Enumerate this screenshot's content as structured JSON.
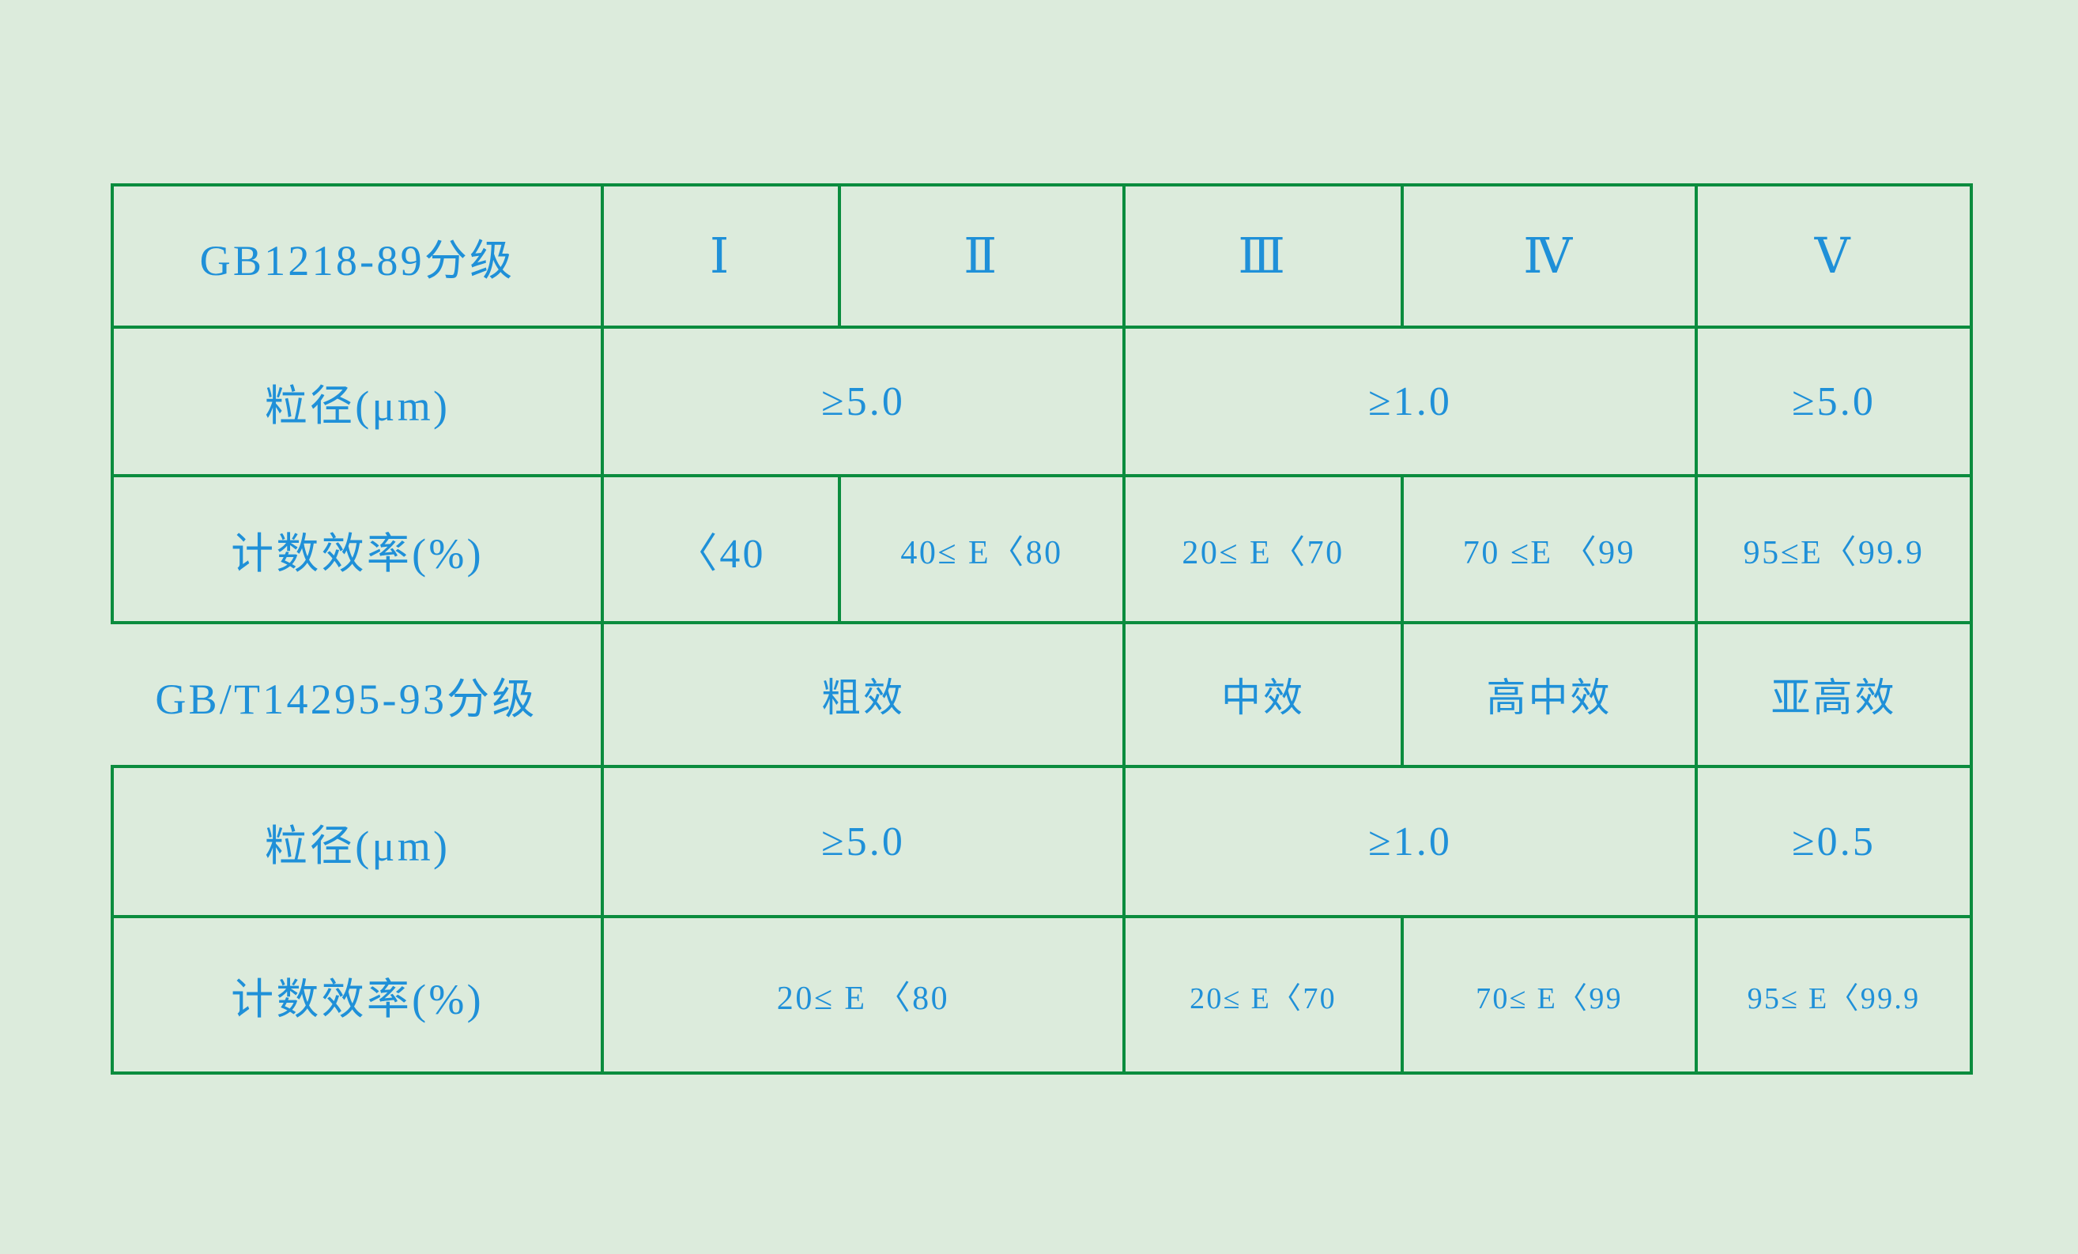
{
  "page": {
    "background_color": "#dcebdc",
    "border_color": "#0b8c3e",
    "text_color": "#1f90d8"
  },
  "table": {
    "row_labels": {
      "gb1218_grade": "GB1218-89分级",
      "particle_size_1": "粒径(μm)",
      "count_efficiency_1": "计数效率(%)",
      "gbt14295_grade": "GB/T14295-93分级",
      "particle_size_2": "粒径(μm)",
      "count_efficiency_2": "计数效率(%)"
    },
    "grade_columns": {
      "c1": "Ⅰ",
      "c2": "Ⅱ",
      "c3": "Ⅲ",
      "c4": "Ⅳ",
      "c5": "Ⅴ"
    },
    "row_particle_size_1": {
      "span_c1_c2": "≥5.0",
      "span_c3_c4": "≥1.0",
      "c5": "≥5.0"
    },
    "row_count_efficiency_1": {
      "c1": "〈40",
      "c2": "40≤ E〈80",
      "c3": "20≤ E〈70",
      "c4": "70 ≤E 〈99",
      "c5": "95≤E〈99.9"
    },
    "row_gbt14295_grade": {
      "span_c1_c2": "粗效",
      "c3": "中效",
      "c4": "高中效",
      "c5": "亚高效"
    },
    "row_particle_size_2": {
      "span_c1_c2": "≥5.0",
      "span_c3_c4": "≥1.0",
      "c5": "≥0.5"
    },
    "row_count_efficiency_2": {
      "span_c1_c2": "20≤ E 〈80",
      "c3": "20≤ E〈70",
      "c4": "70≤ E〈99",
      "c5": "95≤ E〈99.9"
    }
  }
}
